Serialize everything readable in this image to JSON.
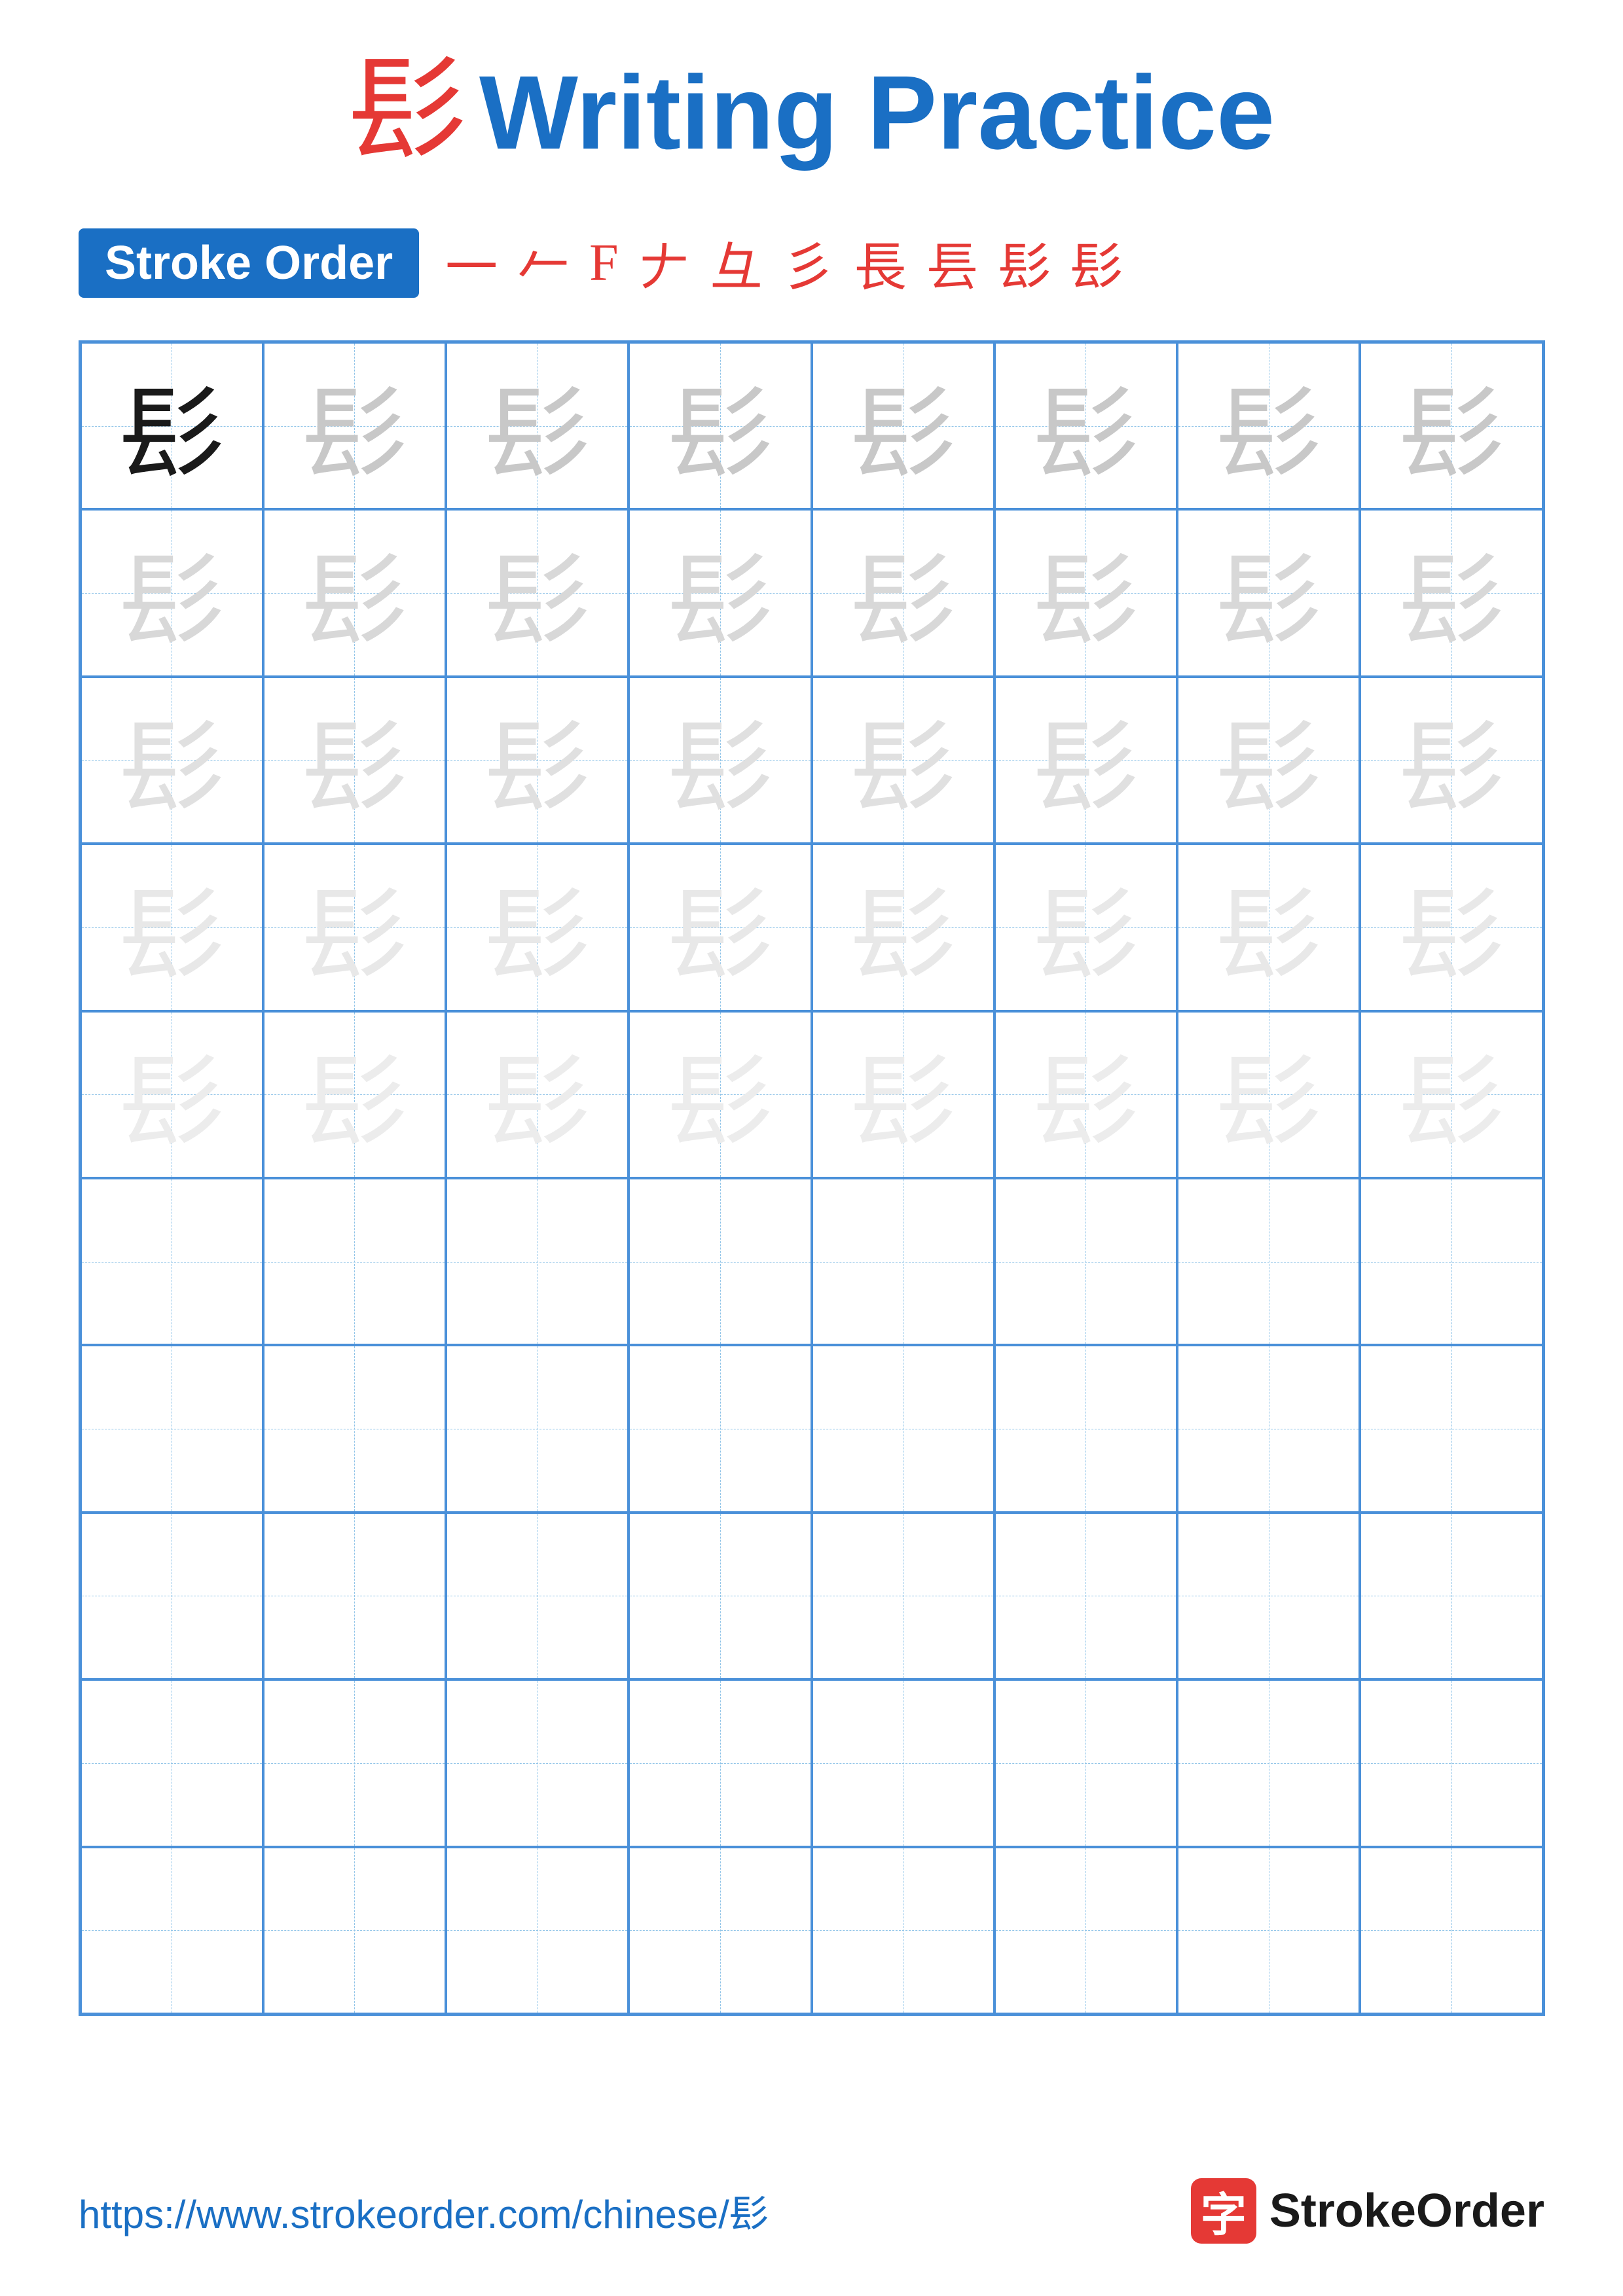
{
  "title": {
    "char": "髟",
    "text": "Writing Practice",
    "char_display": "髟"
  },
  "stroke_order": {
    "badge_label": "Stroke Order",
    "steps": [
      "一",
      "𠂉",
      "F",
      "𠂇",
      "彑",
      "彡",
      "長",
      "镸",
      "髟̀",
      "髟"
    ]
  },
  "grid": {
    "rows": 10,
    "cols": 8,
    "char": "髟",
    "practice_rows": 5,
    "empty_rows": 5
  },
  "footer": {
    "url": "https://www.strokeorder.com/chinese/髟",
    "brand_char": "字",
    "brand_name": "StrokeOrder"
  }
}
